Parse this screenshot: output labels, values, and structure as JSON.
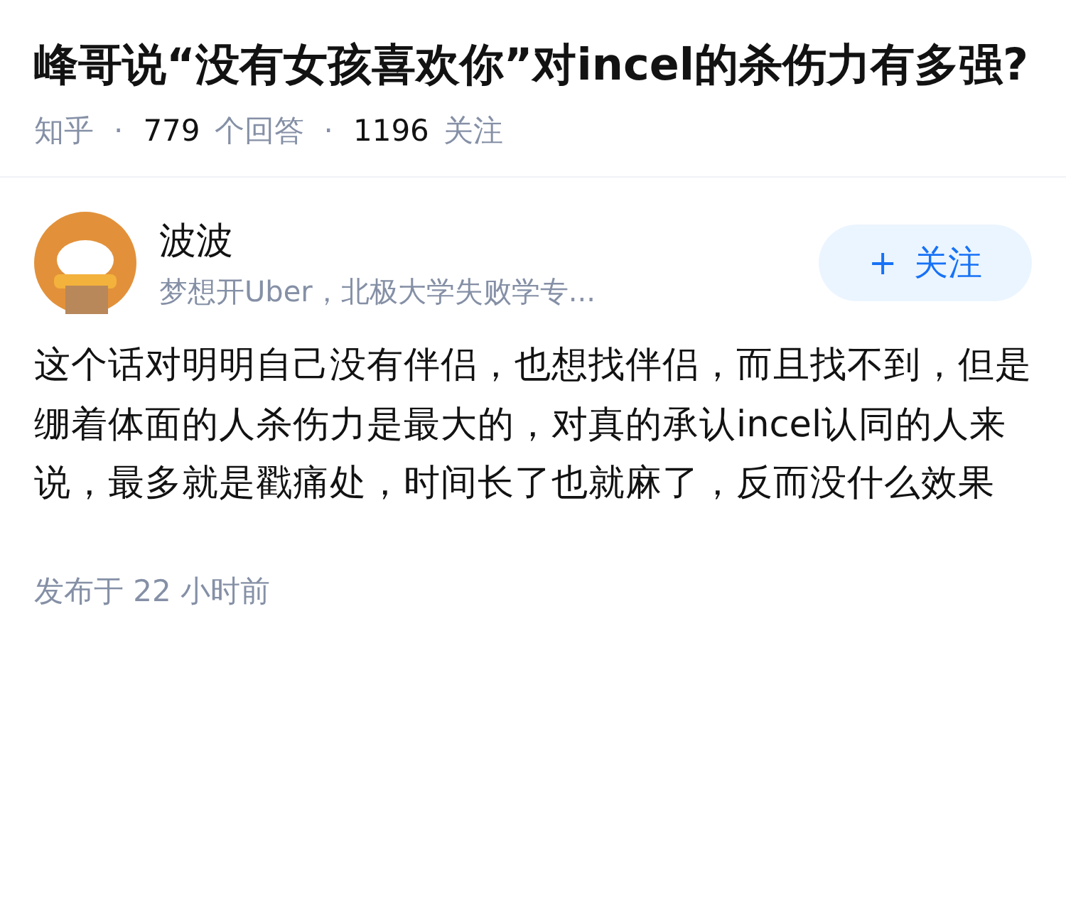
{
  "question": {
    "title": "峰哥说“没有女孩喜欢你”对incel的杀伤力有多强?",
    "source": "知乎",
    "separator": "·",
    "stats": [
      {
        "count": "779",
        "label": "个回答"
      },
      {
        "count": "1196",
        "label": "关注"
      }
    ]
  },
  "answer": {
    "author": {
      "name": "波波",
      "bio": "梦想开Uber，北极大学失败学专..."
    },
    "follow_button": {
      "icon": "+",
      "label": "关注"
    },
    "content": "这个话对明明自己没有伴侣，也想找伴侣，而且找不到，但是绷着体面的人杀伤力是最大的，对真的承认incel认同的人来说，最多就是戳痛处，时间长了也就麻了，反而没什么效果",
    "published": "发布于 22 小时前"
  }
}
